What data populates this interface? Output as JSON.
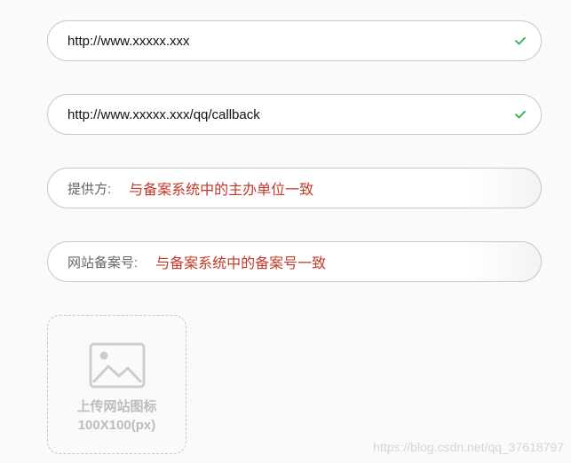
{
  "fields": {
    "website_url": "http://www.xxxxx.xxx",
    "callback_url": "http://www.xxxxx.xxx/qq/callback",
    "provider": {
      "label": "提供方:",
      "note": "与备案系统中的主办单位一致"
    },
    "icp": {
      "label": "网站备案号:",
      "note": "与备案系统中的备案号一致"
    }
  },
  "upload": {
    "line1": "上传网站图标",
    "line2": "100X100(px)",
    "icon": "image-icon"
  },
  "watermark": "https://blog.csdn.net/qq_37618797",
  "colors": {
    "check": "#2bb34a",
    "note_red": "#c0392b",
    "border": "#c9c9c9",
    "placeholder_gray": "#bdbdbd"
  }
}
